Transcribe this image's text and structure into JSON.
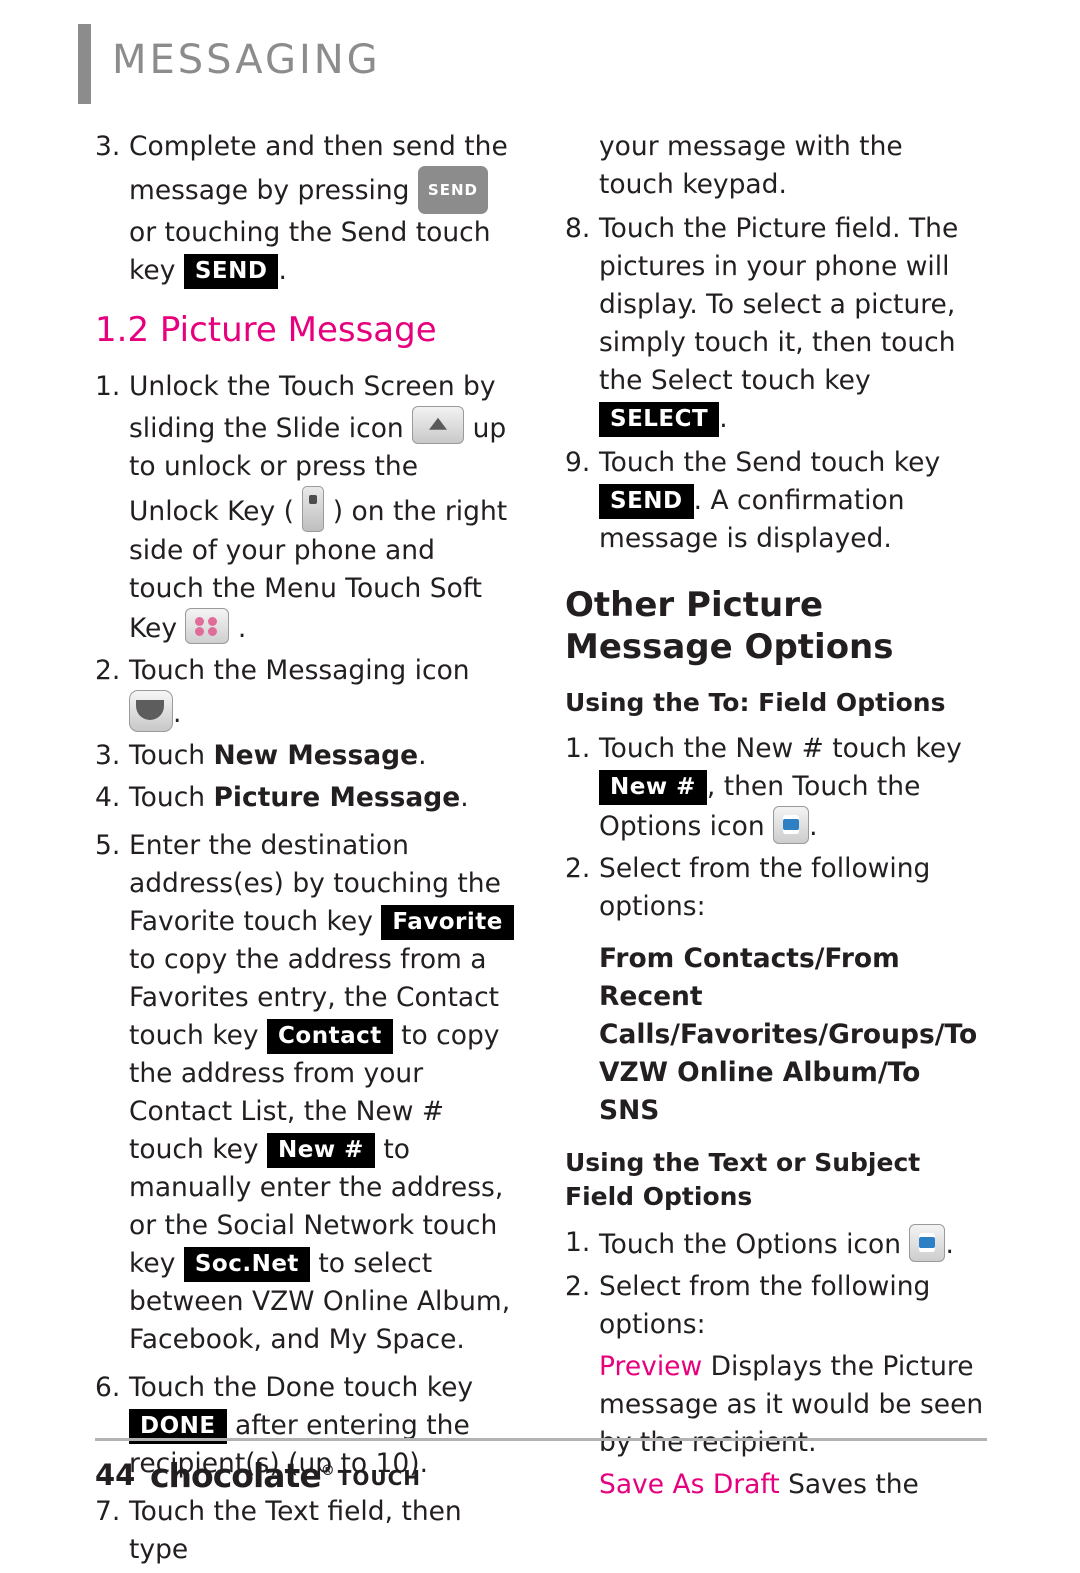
{
  "header": {
    "chapter": "MESSAGING"
  },
  "left_column": {
    "step3": {
      "num": "3.",
      "text_a": "Complete and then send the message by pressing",
      "pill_send": "SEND",
      "text_b": "or touching the Send touch key",
      "key_send": "SEND",
      "text_c": "."
    },
    "section_heading": "1.2 Picture Message",
    "step1": {
      "num": "1.",
      "text_a": "Unlock the Touch Screen by sliding the Slide icon",
      "icon_slide": "slide-icon",
      "text_b": "up to unlock or press the Unlock Key (",
      "icon_unlock": "unlock-key-icon",
      "text_c": ") on the right side of your phone and touch the Menu Touch Soft Key",
      "icon_menu": "menu-grid-icon",
      "text_d": "."
    },
    "step2": {
      "num": "2.",
      "text_a": "Touch the Messaging icon",
      "icon_msg": "messaging-envelope-icon",
      "text_b": "."
    },
    "step3b": {
      "num": "3.",
      "text_a": "Touch ",
      "bold": "New Message",
      "text_b": "."
    },
    "step4": {
      "num": "4.",
      "text_a": "Touch ",
      "bold": "Picture Message",
      "text_b": "."
    },
    "step5": {
      "num": "5.",
      "t1": "Enter the destination address(es) by touching the Favorite touch key",
      "key_favorite": "Favorite",
      "t2": "to copy the address from a Favorites entry, the Contact touch key",
      "key_contact": "Contact",
      "t3": "to copy the address from your Contact List, the New # touch key",
      "key_newnum": "New #",
      "t4": "to manually enter the address, or the Social Network touch key",
      "key_socnet": "Soc.Net",
      "t5": "to select between VZW Online Album, Facebook, and My Space."
    },
    "step6": {
      "num": "6.",
      "t1": "Touch the Done touch key",
      "key_done": "DONE",
      "t2": "after entering the recipient(s) (up to 10)."
    },
    "step7": {
      "num": "7.",
      "t1": "Touch the Text field, then type"
    }
  },
  "right_column": {
    "cont7": "your message with the touch keypad.",
    "step8": {
      "num": "8.",
      "t1": "Touch the Picture field. The pictures in your phone will display. To select a picture, simply touch it, then touch the Select touch key",
      "key_select": "SELECT",
      "t2": "."
    },
    "step9": {
      "num": "9.",
      "t1": "Touch the Send touch key",
      "key_send": "SEND",
      "t2": ". A confirmation message is displayed."
    },
    "heading_other": "Other Picture Message Options",
    "sub_to_field": "Using the To: Field Options",
    "to_step1": {
      "num": "1.",
      "t1": "Touch the New # touch key",
      "key_newnum": "New #",
      "t2": ", then Touch the Options icon",
      "icon_options": "options-list-icon",
      "t3": "."
    },
    "to_step2": {
      "num": "2.",
      "t1": "Select from the following options:"
    },
    "options_bold": "From Contacts/From Recent Calls/Favorites/Groups/To VZW Online Album/To SNS",
    "sub_text_subject": "Using the Text or Subject Field Options",
    "ts_step1": {
      "num": "1.",
      "t1": "Touch the Options icon",
      "icon_options": "options-list-icon",
      "t2": "."
    },
    "ts_step2": {
      "num": "2.",
      "t1": "Select from the following options:"
    },
    "preview": {
      "label": "Preview",
      "text": "Displays the Picture message as it would be seen by the recipient."
    },
    "save_as_draft": {
      "label": "Save As Draft",
      "text": "Saves the"
    }
  },
  "footer": {
    "page": "44",
    "brand": "chocolate",
    "brand_reg": "®",
    "brand_touch": "TOUCH"
  }
}
